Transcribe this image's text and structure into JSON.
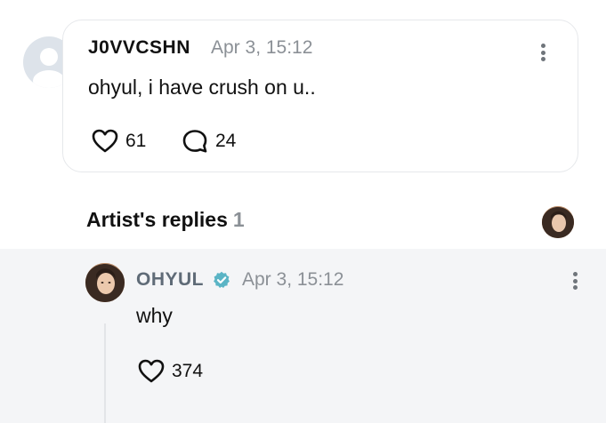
{
  "post": {
    "author": "J0VVCSHN",
    "time": "Apr 3, 15:12",
    "text": "ohyul, i have crush on u..",
    "likes": "61",
    "replies": "24"
  },
  "artist_section": {
    "title": "Artist's replies",
    "count": "1"
  },
  "artist_reply": {
    "author": "OHYUL",
    "time": "Apr 3, 15:12",
    "text": "why",
    "likes": "374"
  },
  "icons": {
    "verified_color": "#5ab4c5",
    "heart": "heart-outline",
    "reply": "speech-bubble-outline",
    "more": "vertical-ellipsis"
  }
}
